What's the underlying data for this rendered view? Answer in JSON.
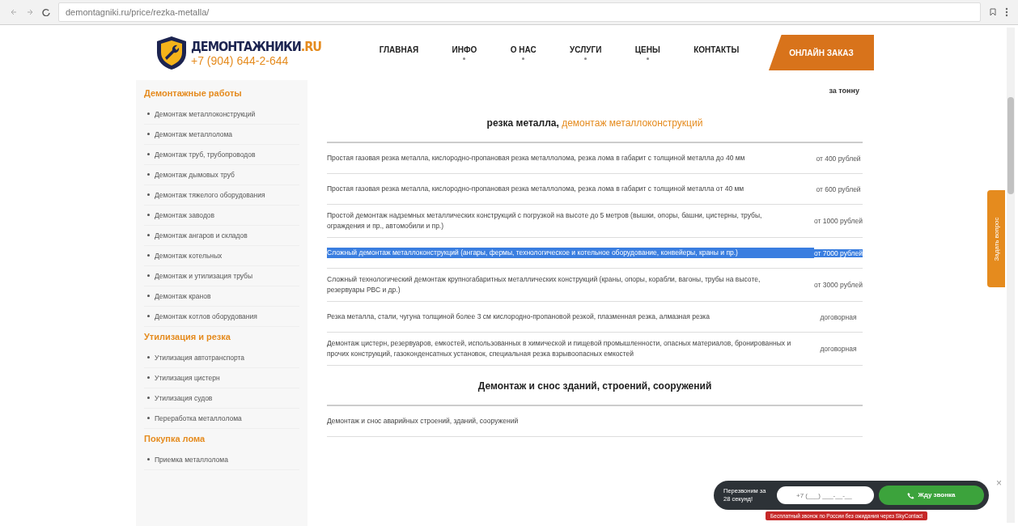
{
  "browser": {
    "url": "demontagniki.ru/price/rezka-metalla/"
  },
  "header": {
    "logo": "ДЕМОНТАЖНИКИ",
    "logo_suffix": ".RU",
    "phone": "+7 (904) 644-2-644",
    "nav": [
      {
        "label": "ГЛАВНАЯ",
        "dropdown": false
      },
      {
        "label": "ИНФО",
        "dropdown": true
      },
      {
        "label": "О НАС",
        "dropdown": true
      },
      {
        "label": "УСЛУГИ",
        "dropdown": true
      },
      {
        "label": "ЦЕНЫ",
        "dropdown": true
      },
      {
        "label": "КОНТАКТЫ",
        "dropdown": false
      }
    ],
    "order_button": "ОНЛАЙН ЗАКАЗ"
  },
  "sidebar": [
    {
      "title": "Демонтажные работы",
      "items": [
        "Демонтаж металлоконструкций",
        "Демонтаж металлолома",
        "Демонтаж труб, трубопроводов",
        "Демонтаж дымовых труб",
        "Демонтаж тяжелого оборудования",
        "Демонтаж заводов",
        "Демонтаж ангаров и складов",
        "Демонтаж котельных",
        "Демонтаж и утилизация трубы",
        "Демонтаж кранов",
        "Демонтаж котлов оборудования"
      ]
    },
    {
      "title": "Утилизация и резка",
      "items": [
        "Утилизация автотранспорта",
        "Утилизация цистерн",
        "Утилизация судов",
        "Переработка металлолома"
      ]
    },
    {
      "title": "Покупка лома",
      "items": [
        "Приемка металлолома"
      ]
    }
  ],
  "price_table": {
    "top_price": "за тонну",
    "sections": [
      {
        "heading": "резка металла, ",
        "heading_link": "демонтаж металлоконструкций",
        "rows": [
          {
            "text": "Простая газовая резка металла, кислородно-пропановая резка металлолома, резка лома в габарит с толщиной металла до 40 мм",
            "price": "от 400 рублей",
            "selected": false
          },
          {
            "text": "Простая газовая резка металла, кислородно-пропановая резка металлолома, резка лома в габарит с толщиной металла от 40 мм",
            "price": "от 600 рублей",
            "selected": false
          },
          {
            "text": "Простой демонтаж надземных металлических конструкций с погрузкой на высоте до 5 метров (вышки, опоры, башни, цистерны, трубы, ограждения и пр., автомобили и пр.)",
            "price": "от 1000 рублей",
            "selected": false
          },
          {
            "text": "Сложный демонтаж металлоконструкций (ангары, фермы, технологическое и котельное оборудование, конвейеры, краны и пр.)",
            "price": "от 7000 рублей",
            "selected": true
          },
          {
            "text": "Сложный технологический демонтаж крупногабаритных металлических конструкций (краны, опоры, корабли, вагоны, трубы на высоте, резервуары РВС и др.)",
            "price": "от 3000 рублей",
            "selected": false
          },
          {
            "text": "Резка металла, стали, чугуна толщиной более 3 см кислородно-пропановой резкой, плазменная резка, алмазная резка",
            "price": "договорная",
            "selected": false
          },
          {
            "text": "Демонтаж цистерн, резервуаров, емкостей, использованных в химической и пищевой промышленности, опасных материалов, бронированных и прочих конструкций, газоконденсатных установок, специальная резка взрывоопасных емкостей",
            "price": "договорная",
            "selected": false
          }
        ]
      },
      {
        "heading": "Демонтаж и снос зданий, строений, сооружений",
        "rows": [
          {
            "text": "Демонтаж и снос аварийных строений, зданий, сооружений",
            "selected": false
          }
        ]
      }
    ]
  },
  "callback": {
    "title": "Перезвоним за 28 секунд!",
    "placeholder": "+7 (___) ___-__-__",
    "button": "Жду звонка",
    "close": "×",
    "notice": "Бесплатный звонок по России без ожидания через SkyContact"
  },
  "side_tab": "Задать вопрос"
}
